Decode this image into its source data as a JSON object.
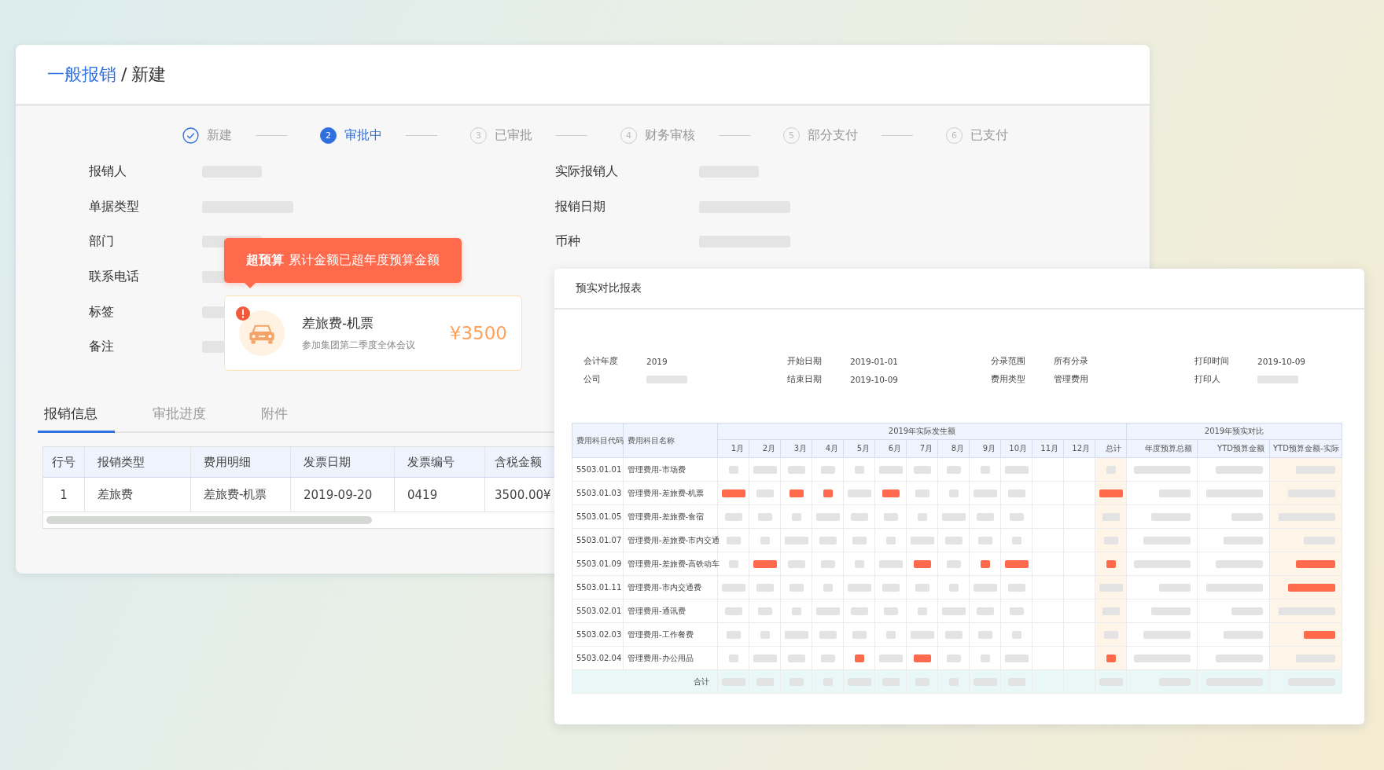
{
  "breadcrumb": {
    "parent": "一般报销",
    "separator": "/",
    "current": "新建"
  },
  "steps": [
    {
      "label": "新建",
      "kind": "done"
    },
    {
      "number": "2",
      "label": "审批中",
      "kind": "active"
    },
    {
      "number": "3",
      "label": "已审批",
      "kind": "pending"
    },
    {
      "number": "4",
      "label": "财务审核",
      "kind": "pending"
    },
    {
      "number": "5",
      "label": "部分支付",
      "kind": "pending"
    },
    {
      "number": "6",
      "label": "已支付",
      "kind": "pending"
    }
  ],
  "form": {
    "left": [
      {
        "label": "报销人",
        "masked": true
      },
      {
        "label": "单据类型",
        "masked": true
      },
      {
        "label": "部门",
        "masked": true
      },
      {
        "label": "联系电话",
        "masked": true
      },
      {
        "label": "标签",
        "masked": true
      },
      {
        "label": "备注",
        "masked": true
      }
    ],
    "right": [
      {
        "label": "实际报销人",
        "masked": true
      },
      {
        "label": "报销日期",
        "masked": true
      },
      {
        "label": "币种",
        "masked": true
      }
    ]
  },
  "alert": {
    "message": "**超预算** 累计金额已超年度预算金额"
  },
  "expense_card": {
    "title": "差旅费-机票",
    "note": "参加集团第二季度全体会议",
    "amount": "¥3500",
    "warning": true
  },
  "tabs": [
    {
      "label": "报销信息",
      "selected": true
    },
    {
      "label": "审批进度",
      "selected": false
    },
    {
      "label": "附件",
      "selected": false
    }
  ],
  "table": {
    "columns": [
      "行号",
      "报销类型",
      "费用明细",
      "发票日期",
      "发票编号",
      "含税金额"
    ],
    "rows": [
      [
        "1",
        "差旅费",
        "差旅费-机票",
        "2019-09-20",
        "0419",
        "3500.00¥"
      ]
    ]
  },
  "report": {
    "title": "预实对比报表",
    "info": [
      {
        "label": "会计年度",
        "value": "2019"
      },
      {
        "label": "开始日期",
        "value": "2019-01-01"
      },
      {
        "label": "分录范围",
        "value": "所有分录"
      },
      {
        "label": "打印时间",
        "value": "2019-10-09"
      },
      {
        "label": "公司",
        "masked": true
      },
      {
        "label": "结束日期",
        "value": "2019-10-09"
      },
      {
        "label": "费用类型",
        "value": "管理费用"
      },
      {
        "label": "打印人",
        "masked": true
      }
    ],
    "table": {
      "columns": [
        "费用科目代码",
        "费用科目名称"
      ],
      "group_actual": "2019年实际发生额",
      "months": [
        "1月",
        "2月",
        "3月",
        "4月",
        "5月",
        "6月",
        "7月",
        "8月",
        "9月",
        "10月",
        "11月",
        "12月",
        "总计"
      ],
      "group_compare": "2019年预实对比",
      "compare_columns": [
        "年度预算总额",
        "YTD预算金额",
        "YTD预算金额-实际"
      ],
      "rows": [
        {
          "code": "5503.01.01",
          "name": "管理费用-市场费",
          "cells": [
            {
              "kind": "bar"
            },
            {
              "kind": "bar"
            },
            {
              "kind": "bar"
            },
            {
              "kind": "bar"
            },
            {
              "kind": "bar"
            },
            {
              "kind": "bar"
            },
            {
              "kind": "bar"
            },
            {
              "kind": "bar"
            },
            {
              "kind": "bar"
            },
            {
              "kind": "bar"
            },
            {
              "kind": "blank"
            },
            {
              "kind": "blank"
            },
            {
              "kind": "bar"
            },
            {
              "kind": "bar"
            },
            {
              "kind": "bar"
            },
            {
              "kind": "bar"
            }
          ]
        },
        {
          "code": "5503.01.03",
          "name": "管理费用-差旅费-机票",
          "cells": [
            {
              "kind": "alert"
            },
            {
              "kind": "bar"
            },
            {
              "kind": "alert"
            },
            {
              "kind": "alert"
            },
            {
              "kind": "bar"
            },
            {
              "kind": "alert"
            },
            {
              "kind": "bar"
            },
            {
              "kind": "bar"
            },
            {
              "kind": "bar"
            },
            {
              "kind": "bar"
            },
            {
              "kind": "blank"
            },
            {
              "kind": "blank"
            },
            {
              "kind": "alert"
            },
            {
              "kind": "bar"
            },
            {
              "kind": "bar"
            },
            {
              "kind": "bar"
            }
          ]
        },
        {
          "code": "5503.01.05",
          "name": "管理费用-差旅费-食宿",
          "cells": [
            {
              "kind": "bar"
            },
            {
              "kind": "bar"
            },
            {
              "kind": "bar"
            },
            {
              "kind": "bar"
            },
            {
              "kind": "bar"
            },
            {
              "kind": "bar"
            },
            {
              "kind": "bar"
            },
            {
              "kind": "bar"
            },
            {
              "kind": "bar"
            },
            {
              "kind": "bar"
            },
            {
              "kind": "blank"
            },
            {
              "kind": "blank"
            },
            {
              "kind": "bar"
            },
            {
              "kind": "bar"
            },
            {
              "kind": "bar"
            },
            {
              "kind": "bar"
            }
          ]
        },
        {
          "code": "5503.01.07",
          "name": "管理费用-差旅费-市内交通",
          "cells": [
            {
              "kind": "bar"
            },
            {
              "kind": "bar"
            },
            {
              "kind": "bar"
            },
            {
              "kind": "bar"
            },
            {
              "kind": "bar"
            },
            {
              "kind": "bar"
            },
            {
              "kind": "bar"
            },
            {
              "kind": "bar"
            },
            {
              "kind": "bar"
            },
            {
              "kind": "bar"
            },
            {
              "kind": "blank"
            },
            {
              "kind": "blank"
            },
            {
              "kind": "bar"
            },
            {
              "kind": "bar"
            },
            {
              "kind": "bar"
            },
            {
              "kind": "bar"
            }
          ]
        },
        {
          "code": "5503.01.09",
          "name": "管理费用-差旅费-高铁动车",
          "cells": [
            {
              "kind": "bar"
            },
            {
              "kind": "alert"
            },
            {
              "kind": "bar"
            },
            {
              "kind": "bar"
            },
            {
              "kind": "bar"
            },
            {
              "kind": "bar"
            },
            {
              "kind": "alert"
            },
            {
              "kind": "bar"
            },
            {
              "kind": "alert"
            },
            {
              "kind": "alert"
            },
            {
              "kind": "blank"
            },
            {
              "kind": "blank"
            },
            {
              "kind": "alert"
            },
            {
              "kind": "bar"
            },
            {
              "kind": "bar"
            },
            {
              "kind": "alert"
            }
          ]
        },
        {
          "code": "5503.01.11",
          "name": "管理费用-市内交通费",
          "cells": [
            {
              "kind": "bar"
            },
            {
              "kind": "bar"
            },
            {
              "kind": "bar"
            },
            {
              "kind": "bar"
            },
            {
              "kind": "bar"
            },
            {
              "kind": "bar"
            },
            {
              "kind": "bar"
            },
            {
              "kind": "bar"
            },
            {
              "kind": "bar"
            },
            {
              "kind": "bar"
            },
            {
              "kind": "blank"
            },
            {
              "kind": "blank"
            },
            {
              "kind": "bar"
            },
            {
              "kind": "bar"
            },
            {
              "kind": "bar"
            },
            {
              "kind": "alert"
            }
          ]
        },
        {
          "code": "5503.02.01",
          "name": "管理费用-通讯费",
          "cells": [
            {
              "kind": "bar"
            },
            {
              "kind": "bar"
            },
            {
              "kind": "bar"
            },
            {
              "kind": "bar"
            },
            {
              "kind": "bar"
            },
            {
              "kind": "bar"
            },
            {
              "kind": "bar"
            },
            {
              "kind": "bar"
            },
            {
              "kind": "bar"
            },
            {
              "kind": "bar"
            },
            {
              "kind": "blank"
            },
            {
              "kind": "blank"
            },
            {
              "kind": "bar"
            },
            {
              "kind": "bar"
            },
            {
              "kind": "bar"
            },
            {
              "kind": "bar"
            }
          ]
        },
        {
          "code": "5503.02.03",
          "name": "管理费用-工作餐费",
          "cells": [
            {
              "kind": "bar"
            },
            {
              "kind": "bar"
            },
            {
              "kind": "bar"
            },
            {
              "kind": "bar"
            },
            {
              "kind": "bar"
            },
            {
              "kind": "bar"
            },
            {
              "kind": "bar"
            },
            {
              "kind": "bar"
            },
            {
              "kind": "bar"
            },
            {
              "kind": "bar"
            },
            {
              "kind": "blank"
            },
            {
              "kind": "blank"
            },
            {
              "kind": "bar"
            },
            {
              "kind": "bar"
            },
            {
              "kind": "bar"
            },
            {
              "kind": "alert"
            }
          ]
        },
        {
          "code": "5503.02.04",
          "name": "管理费用-办公用品",
          "cells": [
            {
              "kind": "bar"
            },
            {
              "kind": "bar"
            },
            {
              "kind": "bar"
            },
            {
              "kind": "bar"
            },
            {
              "kind": "alert"
            },
            {
              "kind": "bar"
            },
            {
              "kind": "alert"
            },
            {
              "kind": "bar"
            },
            {
              "kind": "bar"
            },
            {
              "kind": "bar"
            },
            {
              "kind": "blank"
            },
            {
              "kind": "blank"
            },
            {
              "kind": "alert"
            },
            {
              "kind": "bar"
            },
            {
              "kind": "bar"
            },
            {
              "kind": "bar"
            }
          ]
        }
      ],
      "total": {
        "label": "合计",
        "cells": [
          {
            "kind": "bar"
          },
          {
            "kind": "bar"
          },
          {
            "kind": "bar"
          },
          {
            "kind": "bar"
          },
          {
            "kind": "bar"
          },
          {
            "kind": "bar"
          },
          {
            "kind": "bar"
          },
          {
            "kind": "bar"
          },
          {
            "kind": "bar"
          },
          {
            "kind": "bar"
          },
          {
            "kind": "blank"
          },
          {
            "kind": "blank"
          },
          {
            "kind": "bar"
          },
          {
            "kind": "bar"
          },
          {
            "kind": "bar"
          },
          {
            "kind": "bar"
          }
        ]
      }
    }
  }
}
